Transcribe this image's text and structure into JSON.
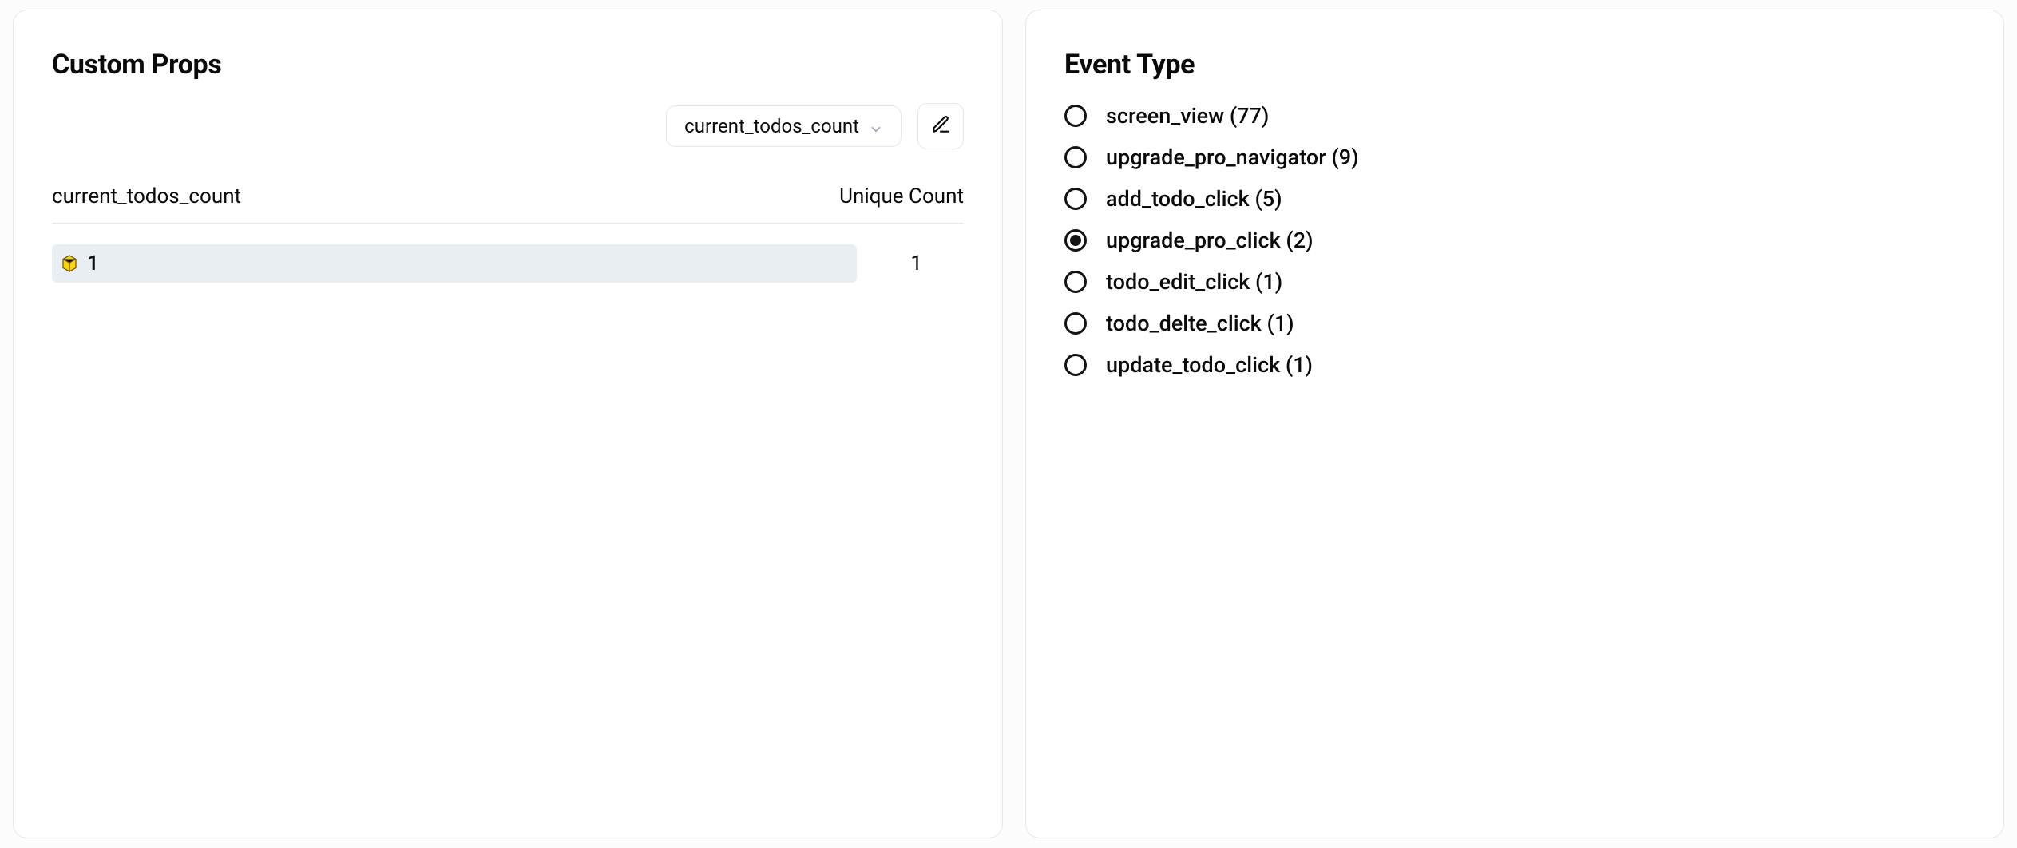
{
  "custom_props": {
    "title": "Custom Props",
    "dropdown_value": "current_todos_count",
    "columns": {
      "key": "current_todos_count",
      "count": "Unique Count"
    },
    "rows": [
      {
        "value": "1",
        "count": "1"
      }
    ]
  },
  "event_type": {
    "title": "Event Type",
    "selected_index": 3,
    "options": [
      {
        "name": "screen_view",
        "count": 77
      },
      {
        "name": "upgrade_pro_navigator",
        "count": 9
      },
      {
        "name": "add_todo_click",
        "count": 5
      },
      {
        "name": "upgrade_pro_click",
        "count": 2
      },
      {
        "name": "todo_edit_click",
        "count": 1
      },
      {
        "name": "todo_delte_click",
        "count": 1
      },
      {
        "name": "update_todo_click",
        "count": 1
      }
    ]
  }
}
